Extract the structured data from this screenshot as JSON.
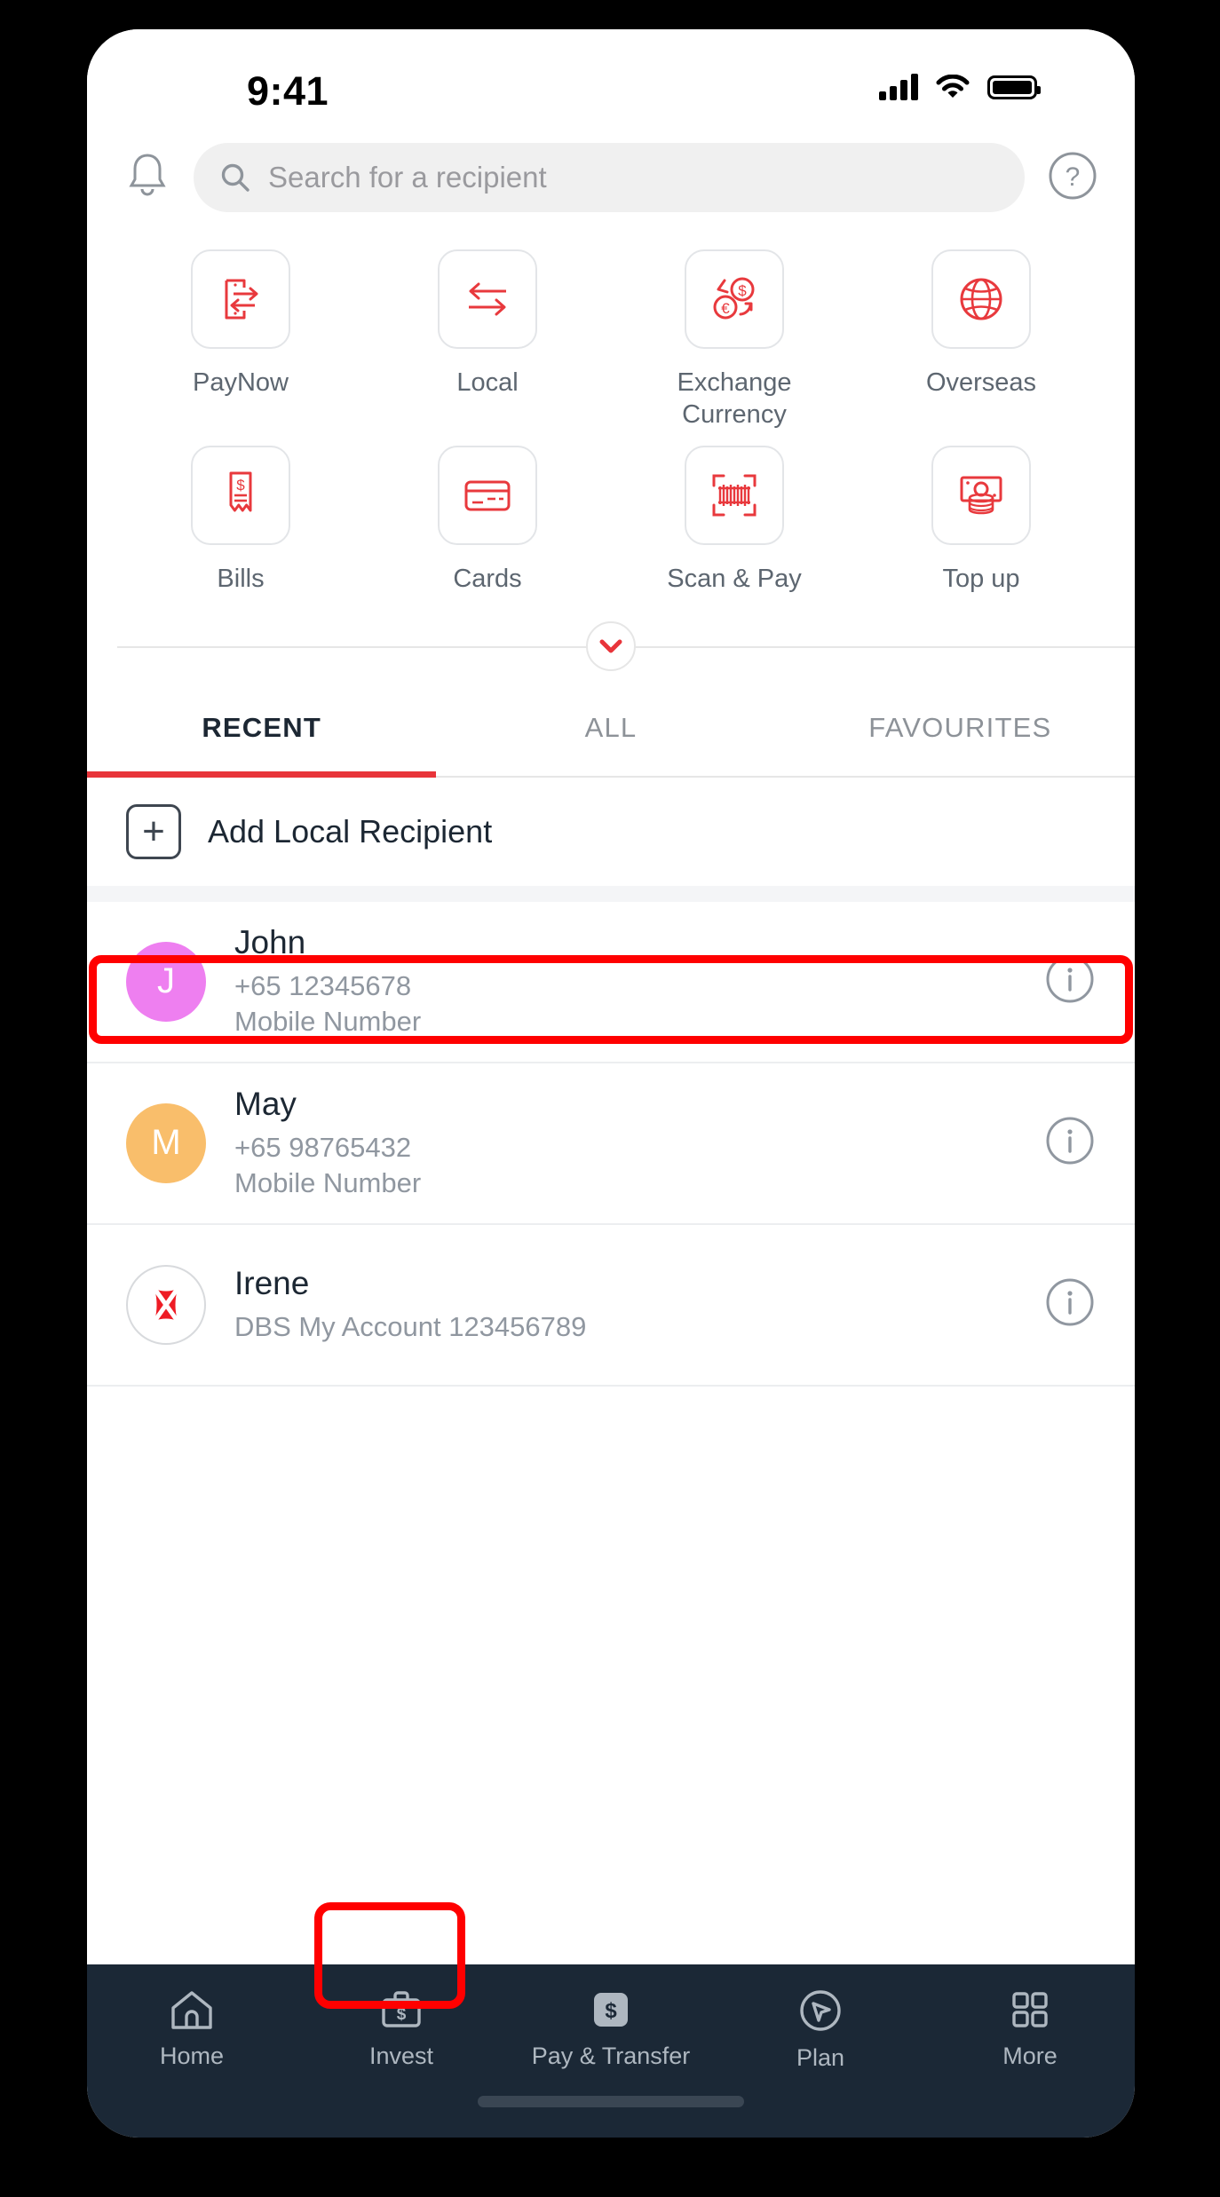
{
  "status_bar": {
    "time": "9:41",
    "signal_icon": "cellular-signal-icon",
    "wifi_icon": "wifi-icon",
    "battery_icon": "battery-full-icon"
  },
  "header": {
    "notifications_icon": "bell-icon",
    "help_icon": "help-circle-icon",
    "search": {
      "icon": "search-icon",
      "placeholder": "Search for a recipient",
      "value": ""
    }
  },
  "quick_actions": [
    {
      "label": "PayNow",
      "icon": "paynow-phone-transfer-icon"
    },
    {
      "label": "Local",
      "icon": "local-transfer-arrows-icon"
    },
    {
      "label": "Exchange Currency",
      "icon": "exchange-currency-icon"
    },
    {
      "label": "Overseas",
      "icon": "globe-icon"
    },
    {
      "label": "Bills",
      "icon": "bill-receipt-icon"
    },
    {
      "label": "Cards",
      "icon": "credit-card-icon"
    },
    {
      "label": "Scan & Pay",
      "icon": "barcode-scan-icon"
    },
    {
      "label": "Top up",
      "icon": "banknote-coins-icon"
    }
  ],
  "expand_button": {
    "icon": "chevron-down-icon"
  },
  "tabs": [
    {
      "label": "RECENT",
      "active": true
    },
    {
      "label": "ALL",
      "active": false
    },
    {
      "label": "FAVOURITES",
      "active": false
    }
  ],
  "add_recipient": {
    "label": "Add Local Recipient",
    "icon": "plus-square-icon"
  },
  "recipients": [
    {
      "name": "John",
      "detail": "+65 12345678",
      "type": "Mobile Number",
      "avatar_initial": "J",
      "avatar_color": "#ee7ff0",
      "avatar_kind": "initial",
      "info_icon": "info-circle-icon"
    },
    {
      "name": "May",
      "detail": "+65 98765432",
      "type": "Mobile Number",
      "avatar_initial": "M",
      "avatar_color": "#f9be6b",
      "avatar_kind": "initial",
      "info_icon": "info-circle-icon"
    },
    {
      "name": "Irene",
      "detail": "DBS My Account 123456789",
      "type": "",
      "avatar_initial": "",
      "avatar_color": "#ffffff",
      "avatar_kind": "bank-logo",
      "info_icon": "info-circle-icon"
    }
  ],
  "bottom_nav": [
    {
      "label": "Home",
      "icon": "home-icon",
      "active": false
    },
    {
      "label": "Invest",
      "icon": "briefcase-dollar-icon",
      "active": false
    },
    {
      "label": "Pay & Transfer",
      "icon": "dollar-badge-icon",
      "active": true
    },
    {
      "label": "Plan",
      "icon": "navigation-arrow-circle-icon",
      "active": false
    },
    {
      "label": "More",
      "icon": "grid-squares-icon",
      "active": false
    }
  ],
  "annotations": [
    {
      "target": "add-local-recipient-row",
      "color": "#ff0000"
    },
    {
      "target": "bottom-nav-pay-transfer",
      "color": "#ff0000"
    }
  ],
  "colors": {
    "brand_red": "#e8343a",
    "icon_red": "#e8393d",
    "nav_background": "#1b2836",
    "text_primary": "#1c2733",
    "text_secondary": "#9097a0",
    "annotation_red": "#ff0000"
  }
}
